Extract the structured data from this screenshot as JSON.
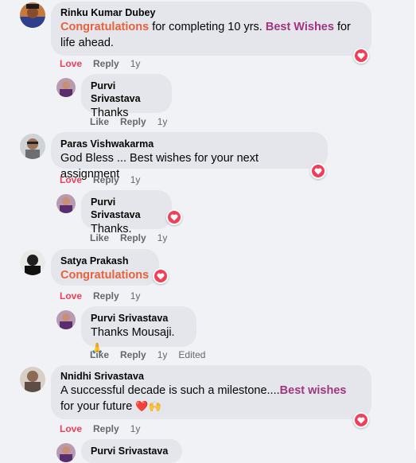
{
  "actions": {
    "love": "Love",
    "like": "Like",
    "reply": "Reply",
    "time": "1y",
    "edited": "Edited"
  },
  "comments": [
    {
      "author": "Rinku Kumar Dubey",
      "t1": "Congratulations",
      "t2": " for completing 10 yrs. ",
      "t3": "Best Wishes",
      "t4": " for life ahead."
    },
    {
      "author": "Purvi Srivastava",
      "text": "Thanks"
    },
    {
      "author": "Paras Vishwakarma",
      "text": "God Bless ... Best wishes for your next assignment"
    },
    {
      "author": "Purvi Srivastava",
      "text": "Thanks."
    },
    {
      "author": "Satya Prakash",
      "text": "Congratulations"
    },
    {
      "author": "Purvi Srivastava",
      "text": "Thanks Mousaji.",
      "emoji": "🙏"
    },
    {
      "author": "Nnidhi Srivastava",
      "t1": "A successful decade is such a milestone....",
      "t2": "Best wishes",
      "t3": " for your future ",
      "emoji": "❤️🙌"
    },
    {
      "author": "Purvi Srivastava"
    }
  ],
  "colors": {
    "love": "#f33e58",
    "congrats": "#e8613c",
    "best_wishes": "#a1357f",
    "bubble": "#e4e6eb",
    "background": "#f0f2f5"
  }
}
